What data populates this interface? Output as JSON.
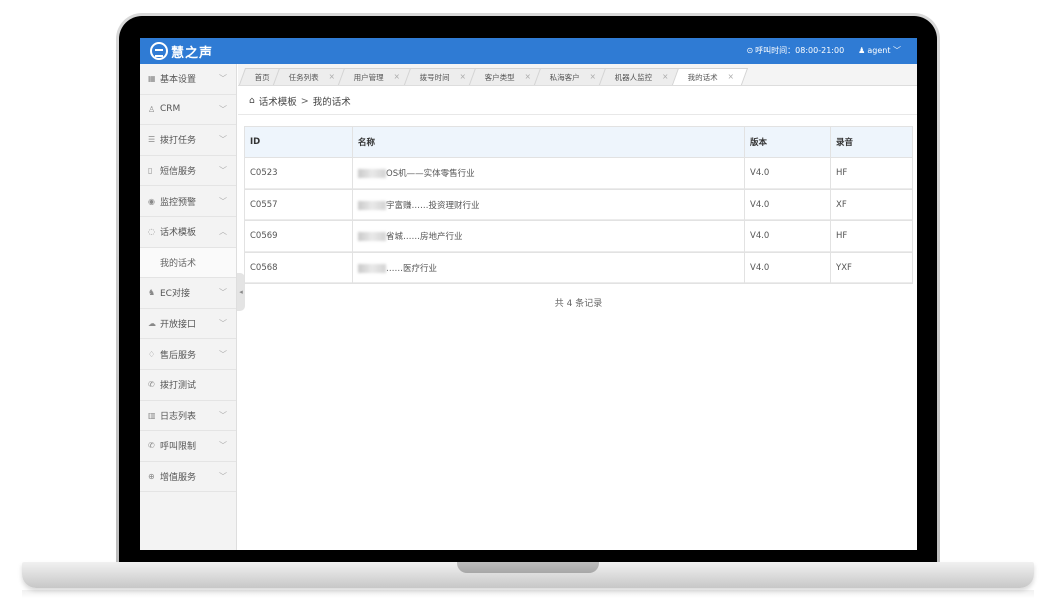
{
  "app": {
    "logo_text": "慧之声"
  },
  "topbar": {
    "call_time": "呼叫时间：08:00-21:00",
    "user": "agent"
  },
  "sidebar": {
    "items": [
      {
        "icon": "grid-icon",
        "glyph": "▦",
        "label": "基本设置",
        "chevron": "﹀"
      },
      {
        "icon": "users-icon",
        "glyph": "♙",
        "label": "CRM",
        "chevron": "﹀"
      },
      {
        "icon": "list-icon",
        "glyph": "☰",
        "label": "拨打任务",
        "chevron": "﹀"
      },
      {
        "icon": "phone-icon",
        "glyph": "▯",
        "label": "短信服务",
        "chevron": "﹀"
      },
      {
        "icon": "eye-icon",
        "glyph": "◉",
        "label": "监控预警",
        "chevron": "﹀"
      },
      {
        "icon": "template-icon",
        "glyph": "◌",
        "label": "话术模板",
        "chevron": "︿"
      },
      {
        "icon": "",
        "glyph": "",
        "label": "我的话术",
        "chevron": "",
        "sub": true
      },
      {
        "icon": "ec-icon",
        "glyph": "♞",
        "label": "EC对接",
        "chevron": "﹀"
      },
      {
        "icon": "cloud-icon",
        "glyph": "☁",
        "label": "开放接口",
        "chevron": "﹀"
      },
      {
        "icon": "service-icon",
        "glyph": "♢",
        "label": "售后服务",
        "chevron": "﹀"
      },
      {
        "icon": "call-test-icon",
        "glyph": "✆",
        "label": "拨打测试",
        "chevron": ""
      },
      {
        "icon": "log-icon",
        "glyph": "▥",
        "label": "日志列表",
        "chevron": "﹀"
      },
      {
        "icon": "call-limit-icon",
        "glyph": "✆",
        "label": "呼叫限制",
        "chevron": "﹀"
      },
      {
        "icon": "plus-icon",
        "glyph": "⊕",
        "label": "增值服务",
        "chevron": "﹀"
      }
    ]
  },
  "tabs": [
    {
      "label": "首页",
      "close": ""
    },
    {
      "label": "任务列表",
      "close": "×"
    },
    {
      "label": "用户管理",
      "close": "×"
    },
    {
      "label": "拨号时间",
      "close": "×"
    },
    {
      "label": "客户类型",
      "close": "×"
    },
    {
      "label": "私海客户",
      "close": "×"
    },
    {
      "label": "机器人监控",
      "close": "×"
    },
    {
      "label": "我的话术",
      "close": "×",
      "active": true
    }
  ],
  "breadcrumb": {
    "parent": "话术模板",
    "separator": ">",
    "current": "我的话术"
  },
  "table": {
    "headers": [
      "ID",
      "名称",
      "版本",
      "录音"
    ],
    "rows": [
      {
        "id": "C0523",
        "name_prefix": "",
        "name": "OS机——实体零售行业",
        "version": "V4.0",
        "recording": "HF"
      },
      {
        "id": "C0557",
        "name_prefix": "",
        "name": "宇富赚……投资理财行业",
        "version": "V4.0",
        "recording": "XF"
      },
      {
        "id": "C0569",
        "name_prefix": "",
        "name": "省城……房地产行业",
        "version": "V4.0",
        "recording": "HF"
      },
      {
        "id": "C0568",
        "name_prefix": "",
        "name": "……医疗行业",
        "version": "V4.0",
        "recording": "YXF"
      }
    ]
  },
  "footer": {
    "total": "共 4 条记录"
  }
}
